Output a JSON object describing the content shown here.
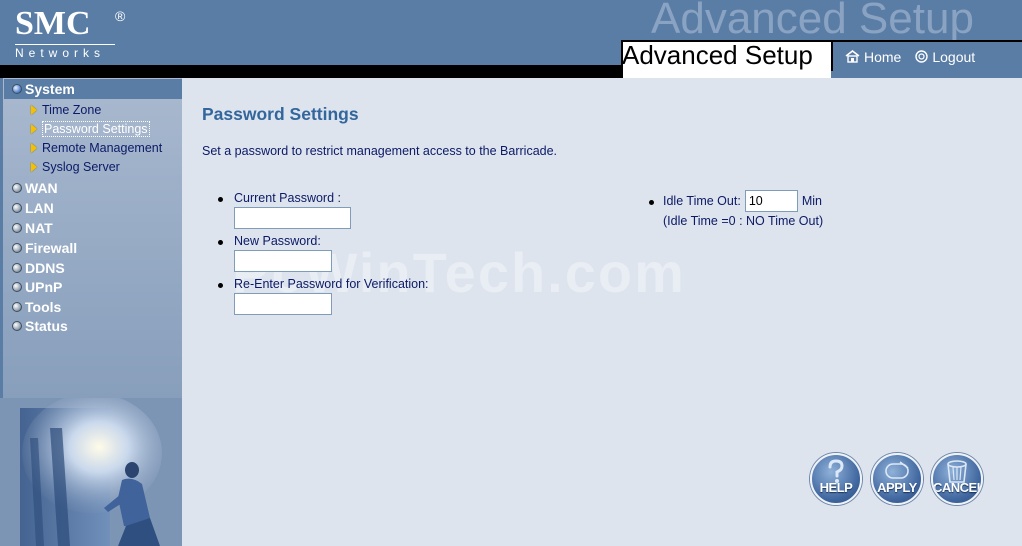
{
  "header": {
    "logo_brand": "SMC",
    "logo_reg": "®",
    "logo_sub": "Networks",
    "watermark_title": "Advanced Setup",
    "page_heading": "Advanced Setup",
    "home_label": "Home",
    "logout_label": "Logout"
  },
  "sidebar": {
    "items": [
      {
        "label": "System",
        "active": true
      },
      {
        "label": "WAN"
      },
      {
        "label": "LAN"
      },
      {
        "label": "NAT"
      },
      {
        "label": "Firewall"
      },
      {
        "label": "DDNS"
      },
      {
        "label": "UPnP"
      },
      {
        "label": "Tools"
      },
      {
        "label": "Status"
      }
    ],
    "subitems": [
      {
        "label": "Time Zone"
      },
      {
        "label": "Password Settings",
        "selected": true
      },
      {
        "label": "Remote Management"
      },
      {
        "label": "Syslog Server"
      }
    ]
  },
  "main": {
    "title": "Password Settings",
    "description": "Set a password to restrict management access to the Barricade.",
    "current_password_label": "Current Password :",
    "current_password_value": "",
    "new_password_label": "New Password:",
    "new_password_value": "",
    "reenter_label": "Re-Enter Password for Verification:",
    "reenter_value": "",
    "idle_label": "Idle Time Out:",
    "idle_value": "10",
    "idle_unit": "Min",
    "idle_note": "(Idle Time =0 : NO Time Out)",
    "watermark": "PcWinTech.com"
  },
  "buttons": {
    "help": "HELP",
    "apply": "APPLY",
    "cancel": "CANCEL"
  },
  "colors": {
    "header_bg": "#5a7da6",
    "content_bg": "#dde4ee",
    "title_blue": "#33669c",
    "text_navy": "#0c1a66",
    "bullet_yellow": "#f4c100"
  }
}
